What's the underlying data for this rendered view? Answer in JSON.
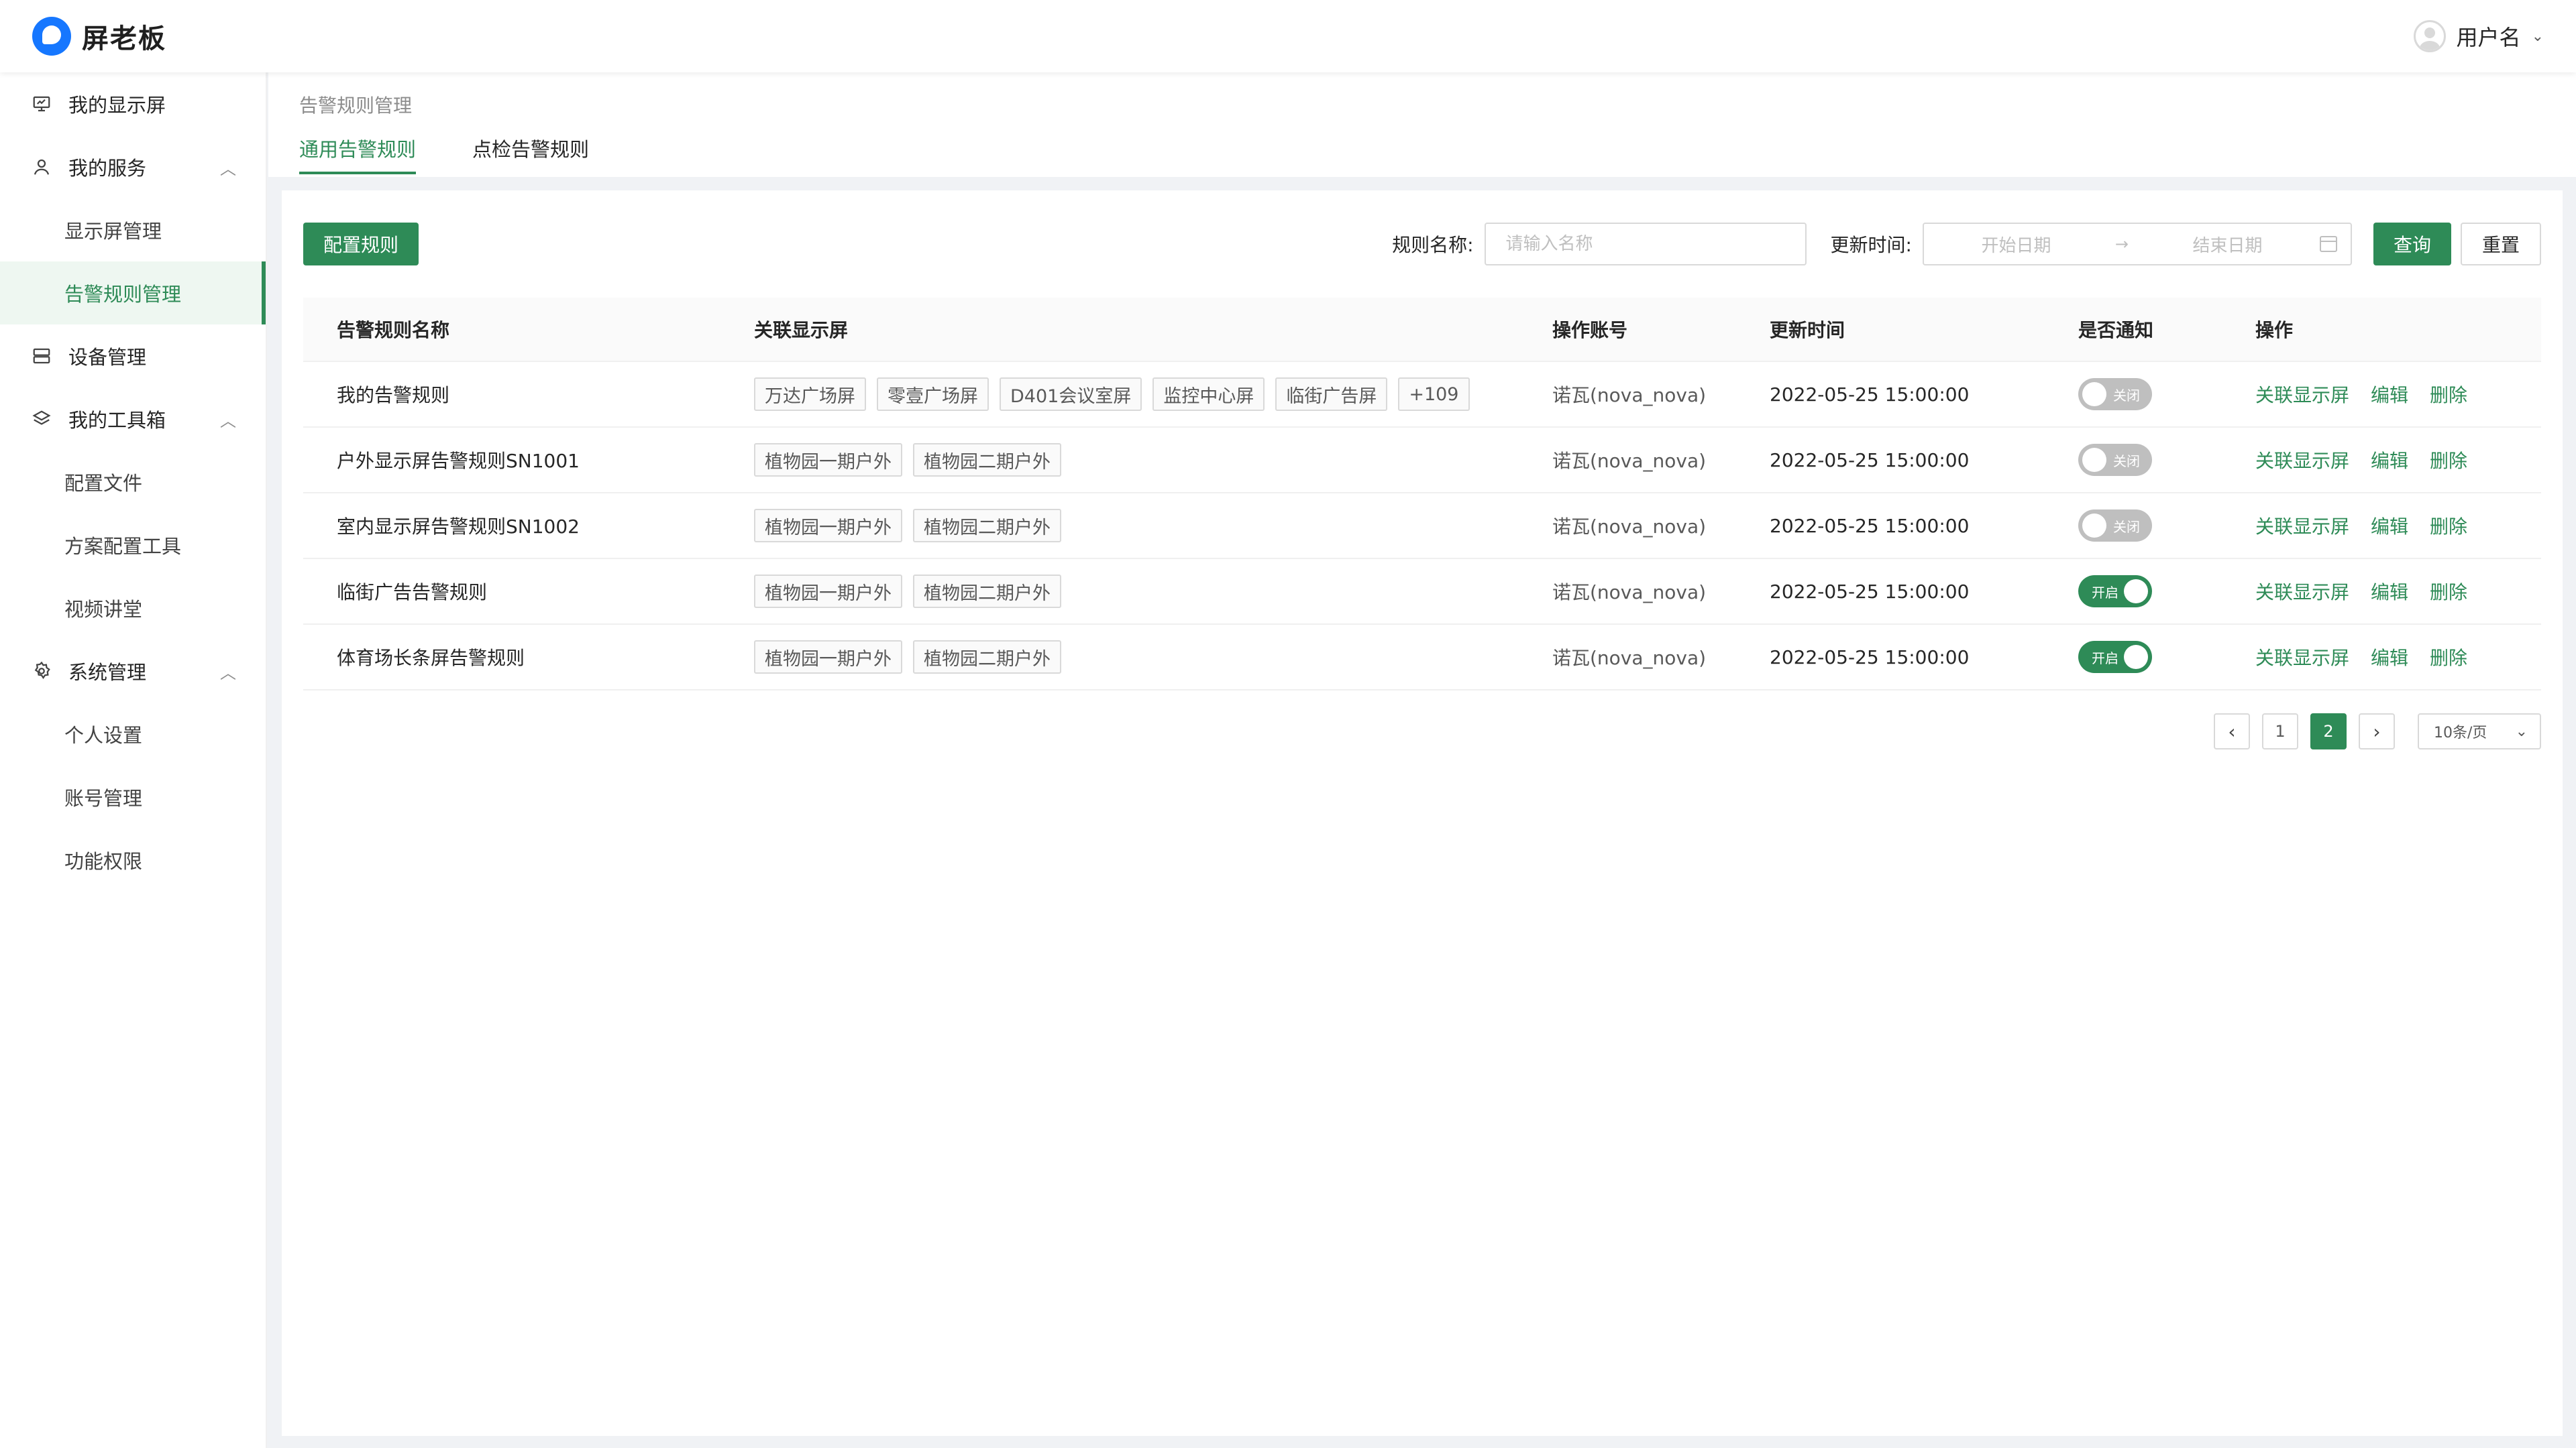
{
  "app": {
    "brand": "屏老板"
  },
  "header": {
    "username": "用户名",
    "caret": "⌄"
  },
  "sidebar": {
    "items": [
      {
        "label": "我的显示屏",
        "icon": "monitor-icon",
        "type": "top"
      },
      {
        "label": "我的服务",
        "icon": "user-icon",
        "type": "parent",
        "arrow": "︿"
      },
      {
        "label": "显示屏管理",
        "type": "sub"
      },
      {
        "label": "告警规则管理",
        "type": "sub",
        "active": true
      },
      {
        "label": "设备管理",
        "icon": "device-icon",
        "type": "top"
      },
      {
        "label": "我的工具箱",
        "icon": "layers-icon",
        "type": "parent",
        "arrow": "︿"
      },
      {
        "label": "配置文件",
        "type": "sub"
      },
      {
        "label": "方案配置工具",
        "type": "sub"
      },
      {
        "label": "视频讲堂",
        "type": "sub"
      },
      {
        "label": "系统管理",
        "icon": "gear-icon",
        "type": "parent",
        "arrow": "︿"
      },
      {
        "label": "个人设置",
        "type": "sub"
      },
      {
        "label": "账号管理",
        "type": "sub"
      },
      {
        "label": "功能权限",
        "type": "sub"
      }
    ]
  },
  "page": {
    "breadcrumb": "告警规则管理",
    "tabs": [
      {
        "label": "通用告警规则",
        "active": true
      },
      {
        "label": "点检告警规则",
        "active": false
      }
    ]
  },
  "toolbar": {
    "config_button": "配置规则",
    "name_label": "规则名称:",
    "name_placeholder": "请输入名称",
    "time_label": "更新时间:",
    "start_placeholder": "开始日期",
    "range_arrow": "→",
    "end_placeholder": "结束日期",
    "query_button": "查询",
    "reset_button": "重置"
  },
  "table": {
    "columns": [
      "告警规则名称",
      "关联显示屏",
      "操作账号",
      "更新时间",
      "是否通知",
      "操作"
    ],
    "switch_on_text": "开启",
    "switch_off_text": "关闭",
    "ops": [
      "关联显示屏",
      "编辑",
      "删除"
    ],
    "rows": [
      {
        "name": "我的告警规则",
        "screens": [
          "万达广场屏",
          "零壹广场屏",
          "D401会议室屏",
          "监控中心屏",
          "临街广告屏",
          "+109"
        ],
        "account": "诺瓦(nova_nova)",
        "time": "2022-05-25 15:00:00",
        "notify": false
      },
      {
        "name": "户外显示屏告警规则SN1001",
        "screens": [
          "植物园一期户外",
          "植物园二期户外"
        ],
        "account": "诺瓦(nova_nova)",
        "time": "2022-05-25 15:00:00",
        "notify": false
      },
      {
        "name": "室内显示屏告警规则SN1002",
        "screens": [
          "植物园一期户外",
          "植物园二期户外"
        ],
        "account": "诺瓦(nova_nova)",
        "time": "2022-05-25 15:00:00",
        "notify": false
      },
      {
        "name": "临街广告告警规则",
        "screens": [
          "植物园一期户外",
          "植物园二期户外"
        ],
        "account": "诺瓦(nova_nova)",
        "time": "2022-05-25 15:00:00",
        "notify": true
      },
      {
        "name": "体育场长条屏告警规则",
        "screens": [
          "植物园一期户外",
          "植物园二期户外"
        ],
        "account": "诺瓦(nova_nova)",
        "time": "2022-05-25 15:00:00",
        "notify": true
      }
    ]
  },
  "pagination": {
    "prev": "‹",
    "next": "›",
    "pages": [
      "1",
      "2"
    ],
    "current": "2",
    "page_size": "10条/页",
    "page_size_caret": "⌄"
  },
  "colors": {
    "accent": "#2e8b57",
    "brand_blue": "#1677ff"
  }
}
